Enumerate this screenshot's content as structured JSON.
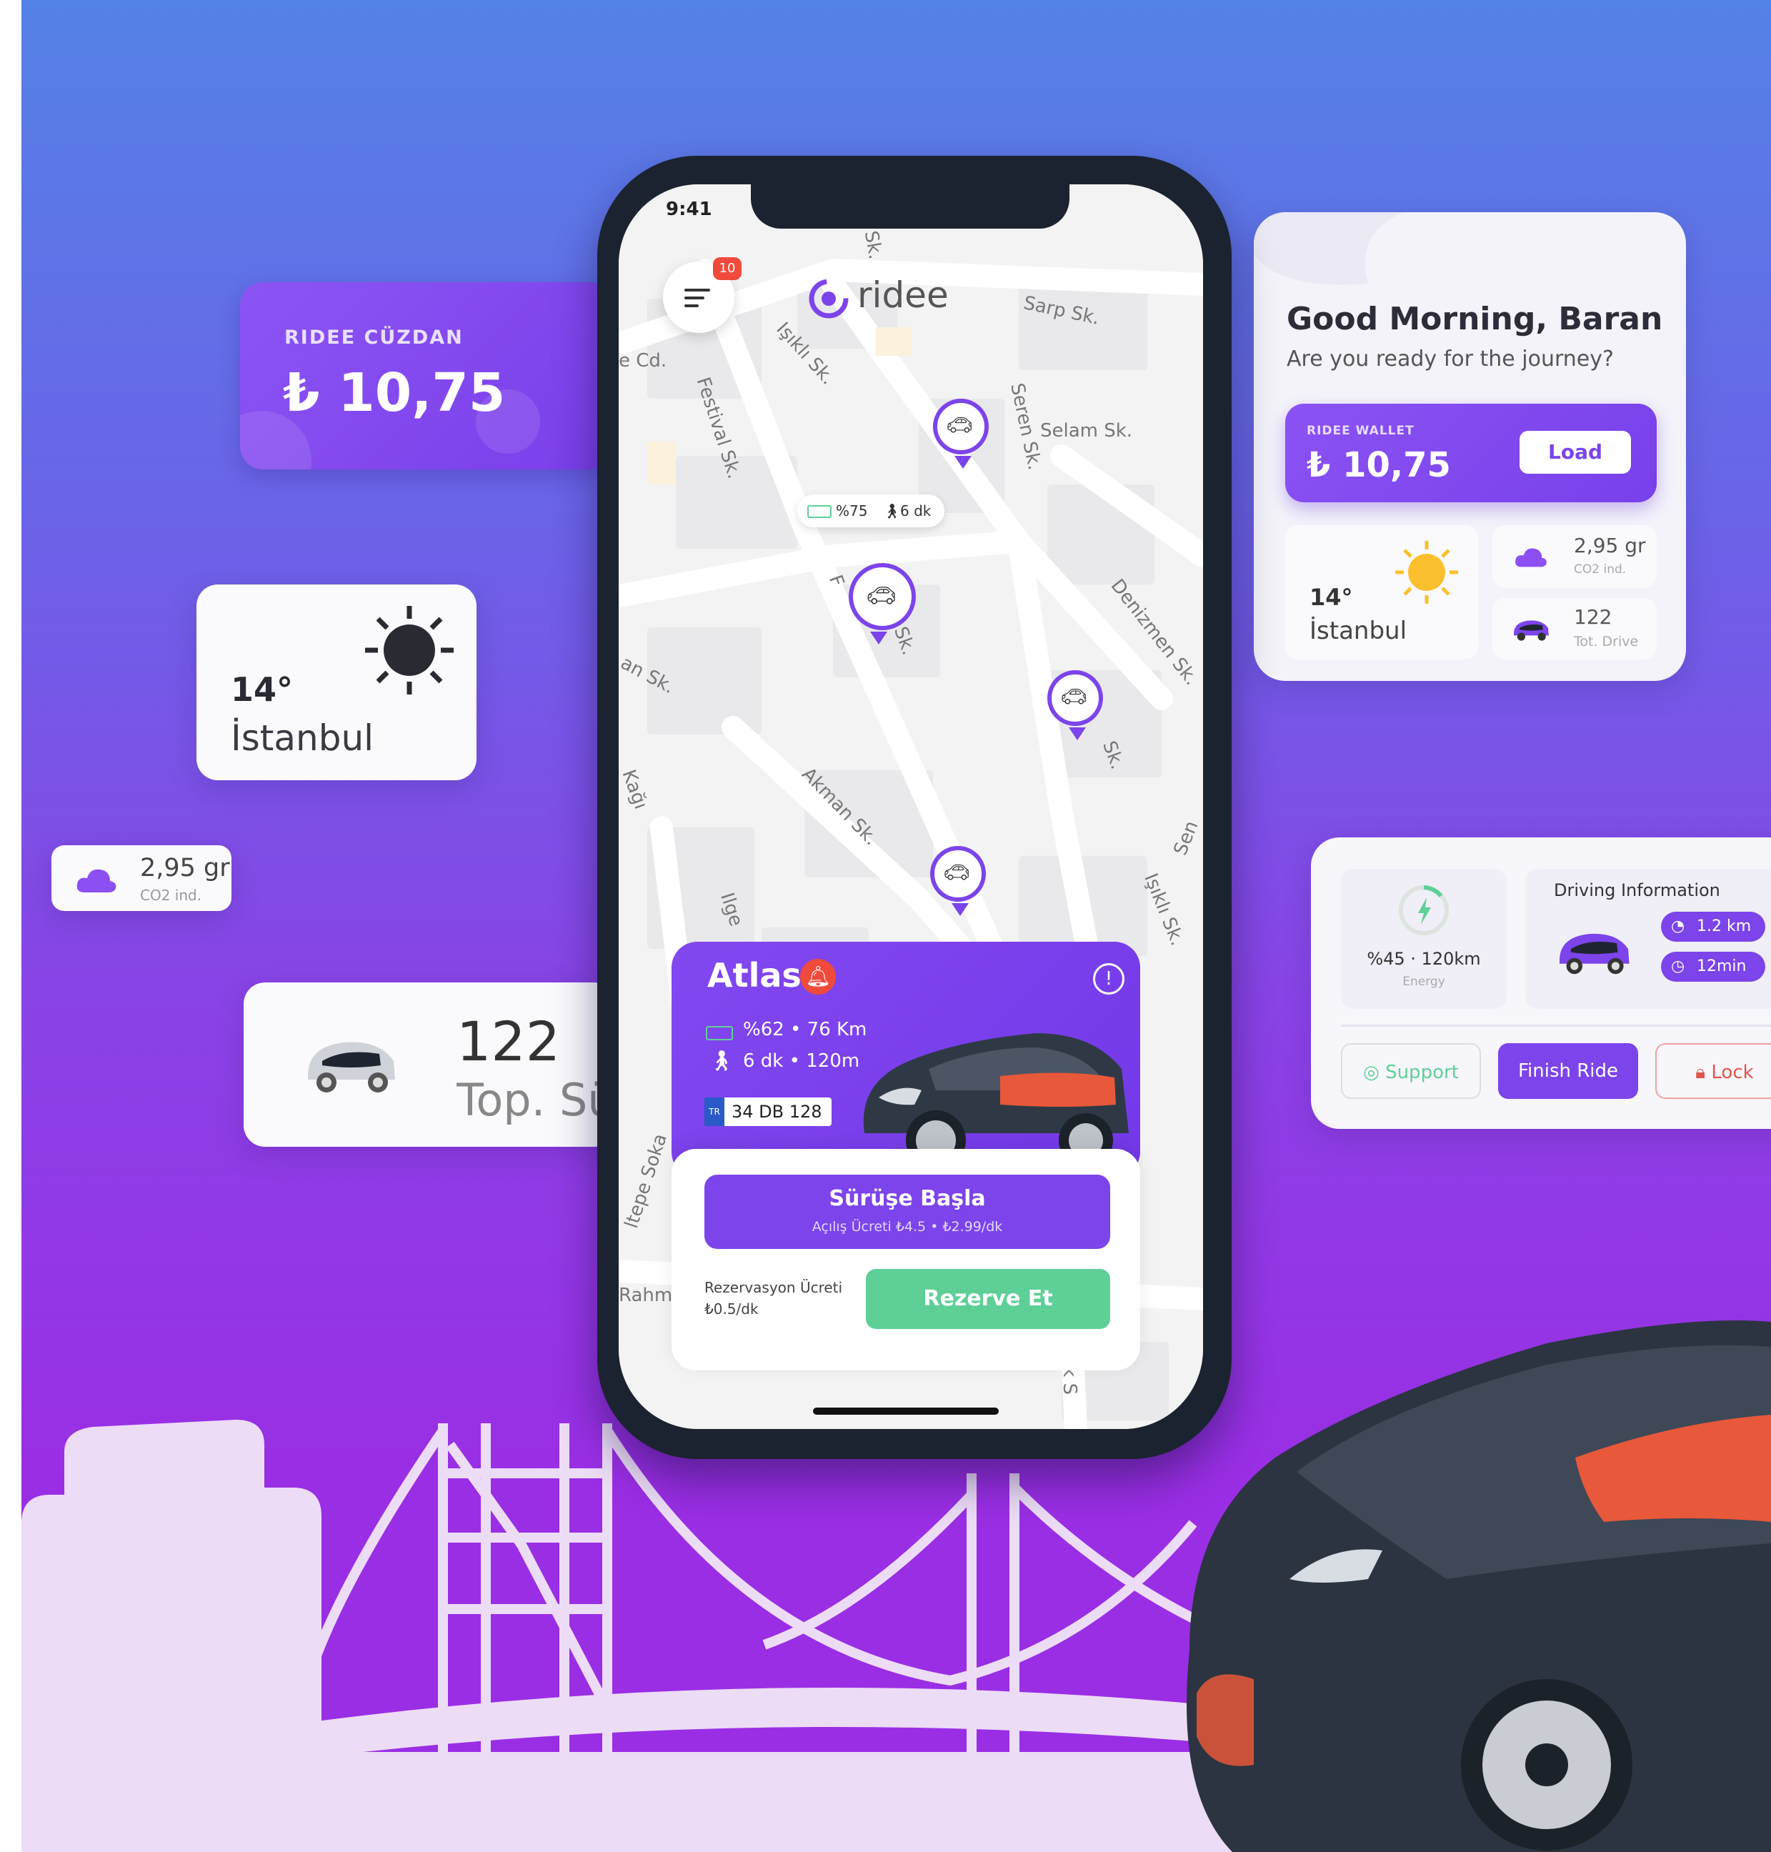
{
  "poster": {
    "wallet_card": {
      "title": "RIDEE CÜZDAN",
      "amount": "₺ 10,75"
    },
    "weather_card": {
      "temperature": "14°",
      "city": "İstanbul"
    },
    "co2_pill": {
      "value": "2,95 gr",
      "label": "CO2 ind."
    },
    "drive_card": {
      "value": "122",
      "label": "Top. Sü"
    }
  },
  "phone": {
    "status_time": "9:41",
    "menu_badge": "10",
    "logo": "ridee",
    "streets": [
      "e Cd.",
      "Işıklı Sk.",
      "Sarp Sk.",
      "Festival Sk.",
      "Seren Sk.",
      "Selam Sk.",
      "Denizmen Sk.",
      "an Sk.",
      "Akman Sk.",
      "Işıklı Sk.",
      "Rahm",
      "Çıkrık S",
      "Sen",
      "Sk.",
      "Sk.",
      "Sk.",
      "ltepe Soka",
      "Ilge",
      "Kağı",
      "F"
    ],
    "map_tooltip": {
      "battery": "%75",
      "walk": "6 dk"
    },
    "sheet": {
      "car_name": "Atlas",
      "battery": "%62 • 76 Km",
      "walk": "6 dk • 120m",
      "plate_prefix": "TR",
      "plate": "34 DB 128",
      "start_label": "Sürüşe Başla",
      "start_sub": "Açılış Ücreti ₺4.5 • ₺2.99/dk",
      "reserve_fee_label": "Rezervasyon Ücreti",
      "reserve_fee_value": "₺0.5/dk",
      "reserve_button": "Rezerve Et"
    }
  },
  "greet_card": {
    "title": "Good Morning, Baran",
    "subtitle": "Are you ready for the journey?",
    "wallet_title": "RIDEE WALLET",
    "wallet_amount": "₺ 10,75",
    "load_label": "Load",
    "temperature": "14°",
    "city": "İstanbul",
    "co2_value": "2,95 gr",
    "co2_label": "CO2 ind.",
    "drive_value": "122",
    "drive_label": "Tot. Drive"
  },
  "info_card": {
    "energy_value": "%45 · 120km",
    "energy_label": "Energy",
    "title": "Driving Information",
    "distance": "1.2 km",
    "duration": "12min",
    "support_label": "Support",
    "finish_label": "Finish Ride",
    "lock_label": "Lock"
  },
  "colors": {
    "brand_purple": "#7c44ea",
    "reserve_green": "#5fcf98",
    "alert_red": "#f04a3c",
    "car_body": "#2b3440",
    "car_accent": "#e8583a"
  },
  "icons": [
    "menu-icon",
    "logo-icon",
    "car-pin-icon",
    "battery-icon",
    "walk-icon",
    "bell-icon",
    "info-icon",
    "cloud-icon",
    "sun-icon",
    "car-icon",
    "bolt-icon",
    "speedometer-icon",
    "clock-icon",
    "support-icon",
    "lock-icon"
  ]
}
